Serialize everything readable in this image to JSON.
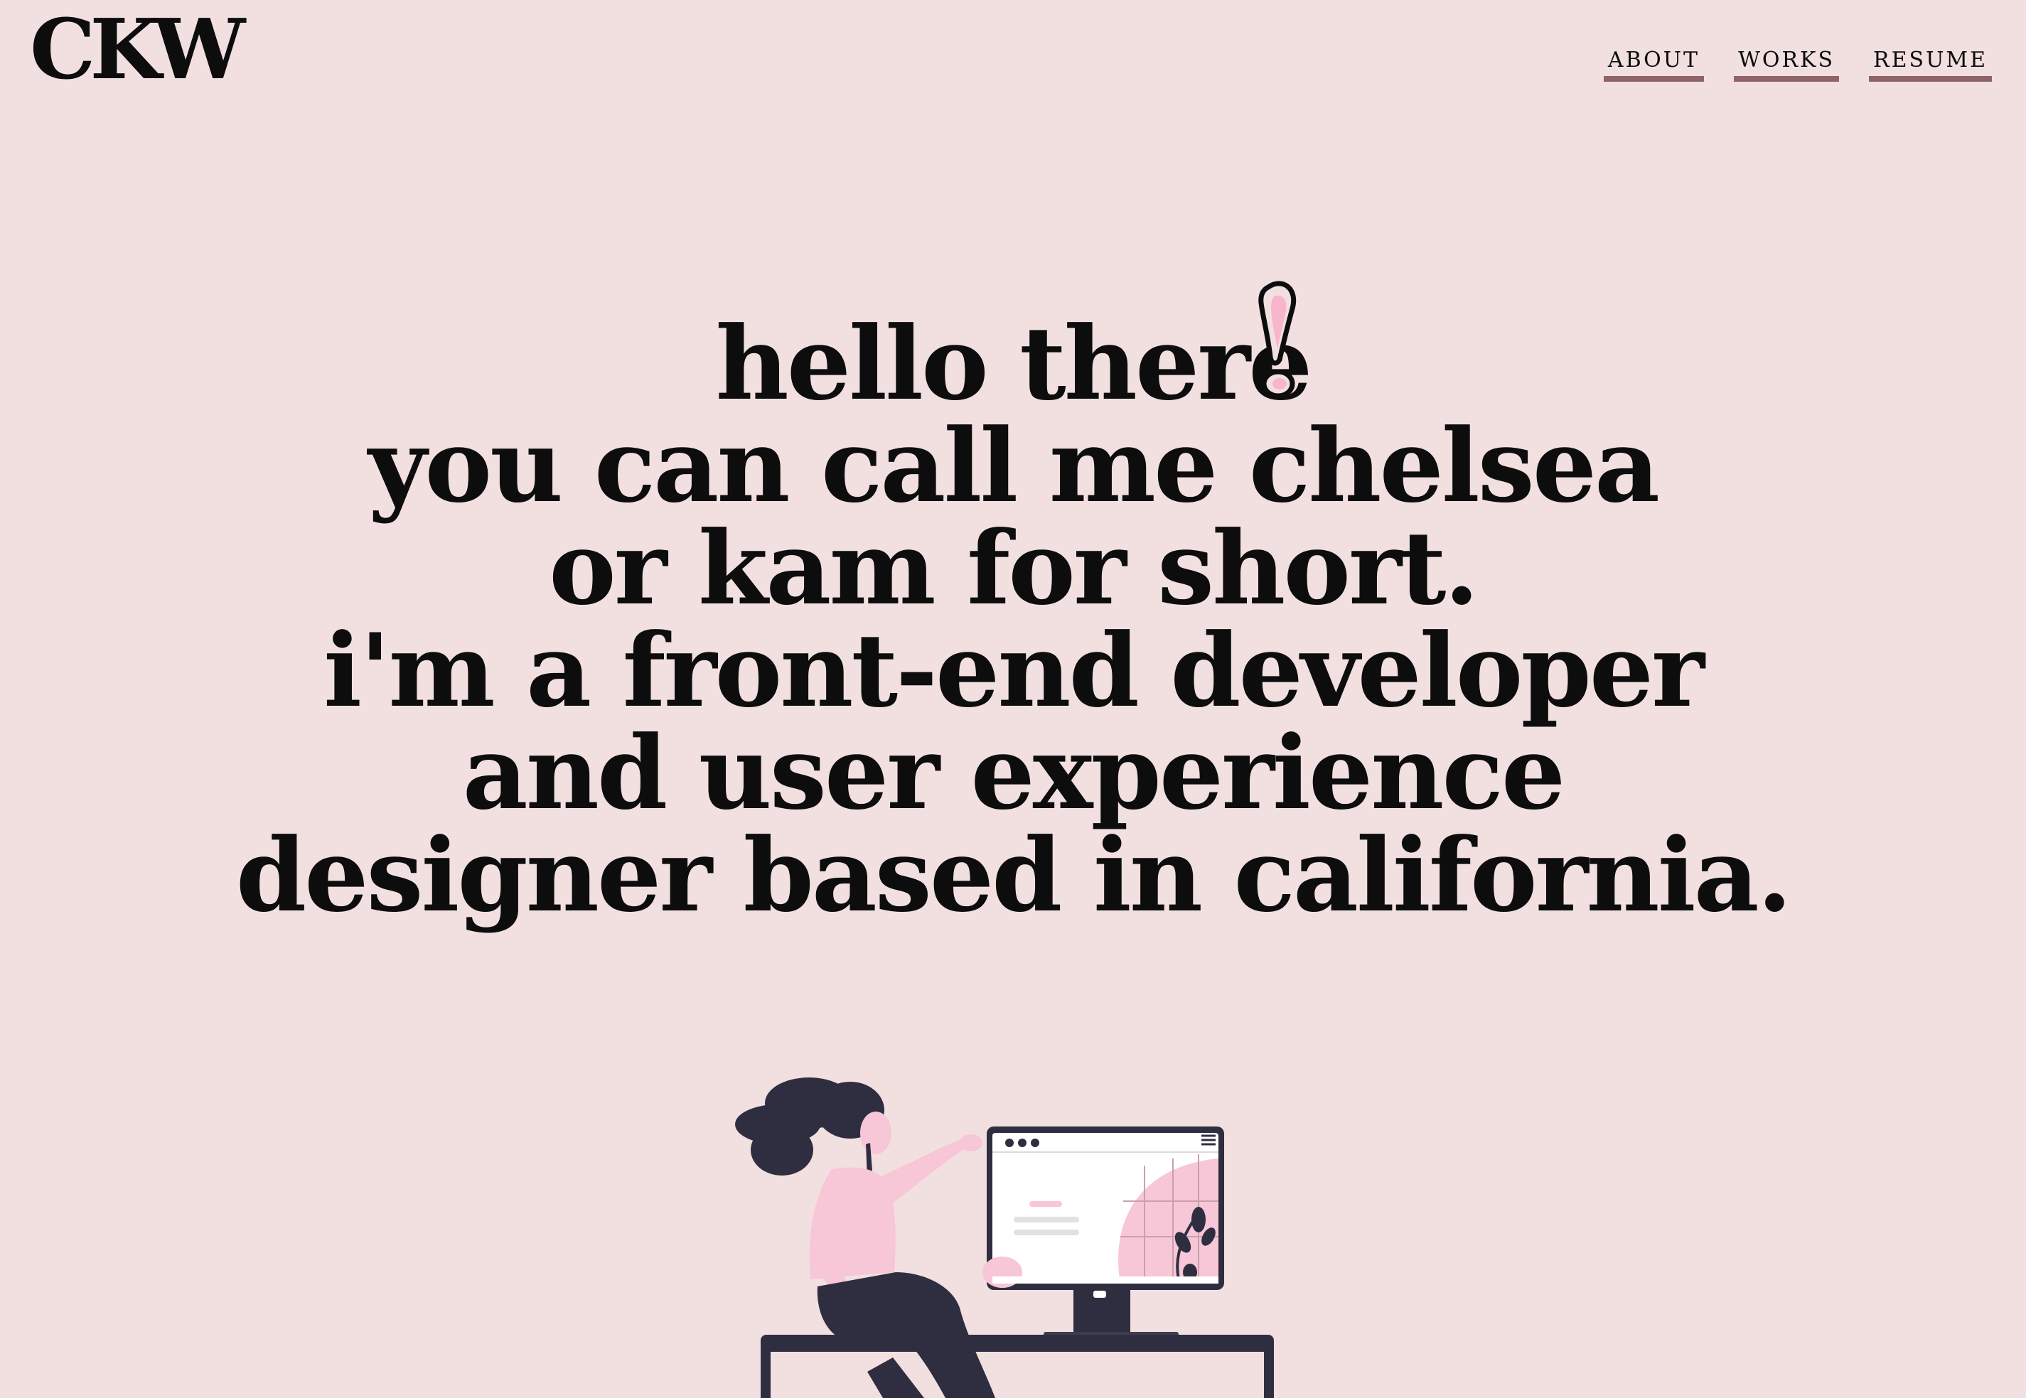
{
  "header": {
    "logo": "CKW",
    "nav": [
      {
        "label": "ABOUT"
      },
      {
        "label": "WORKS"
      },
      {
        "label": "RESUME"
      }
    ]
  },
  "hero": {
    "lines": [
      "hello there",
      "you can call me chelsea",
      "or kam for short.",
      "i'm a front-end developer",
      "and user experience",
      "designer based in california."
    ]
  },
  "colors": {
    "background": "#f2e0e0",
    "text": "#0d0d0d",
    "nav_underline": "#8f6467",
    "accent_pink": "#f7c6d7",
    "illustration_dark": "#2f2e41"
  },
  "icons": {
    "exclamation": "exclamation-doodle-icon",
    "illustration": "developer-at-desk-illustration"
  }
}
